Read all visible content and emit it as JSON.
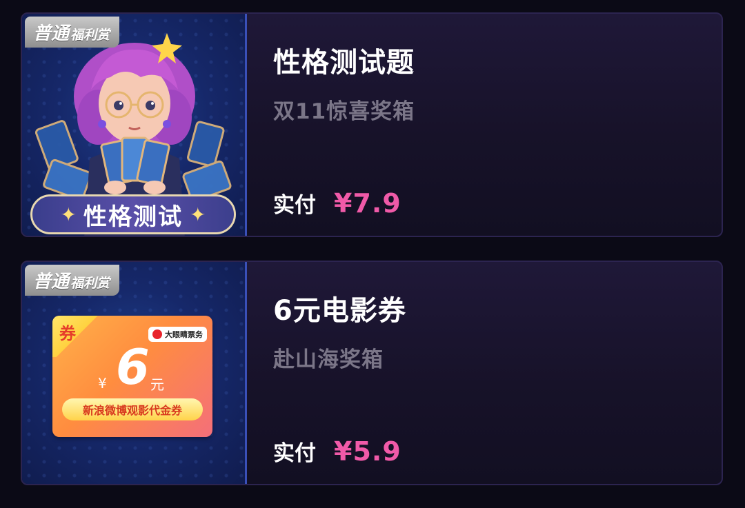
{
  "items": [
    {
      "tag": {
        "big": "普通",
        "small": "福利赏"
      },
      "title": "性格测试题",
      "subtitle": "双11惊喜奖箱",
      "pay_label": "实付",
      "price": "¥7.9",
      "thumb": {
        "type": "tarot-girl",
        "banner": "性格测试",
        "sparkle_icon": "sparkle-icon"
      }
    },
    {
      "tag": {
        "big": "普通",
        "small": "福利赏"
      },
      "title": "6元电影券",
      "subtitle": "赴山海奖箱",
      "pay_label": "实付",
      "price": "¥5.9",
      "thumb": {
        "type": "coupon",
        "corner": "券",
        "brand": "大眼睛票务",
        "yen": "¥",
        "amount": "6",
        "unit": "元",
        "desc": "新浪微博观影代金券"
      }
    }
  ],
  "colors": {
    "background": "#0b0a16",
    "card": "#1a1430",
    "price": "#f05aa8",
    "subtitle": "#7b7688"
  }
}
